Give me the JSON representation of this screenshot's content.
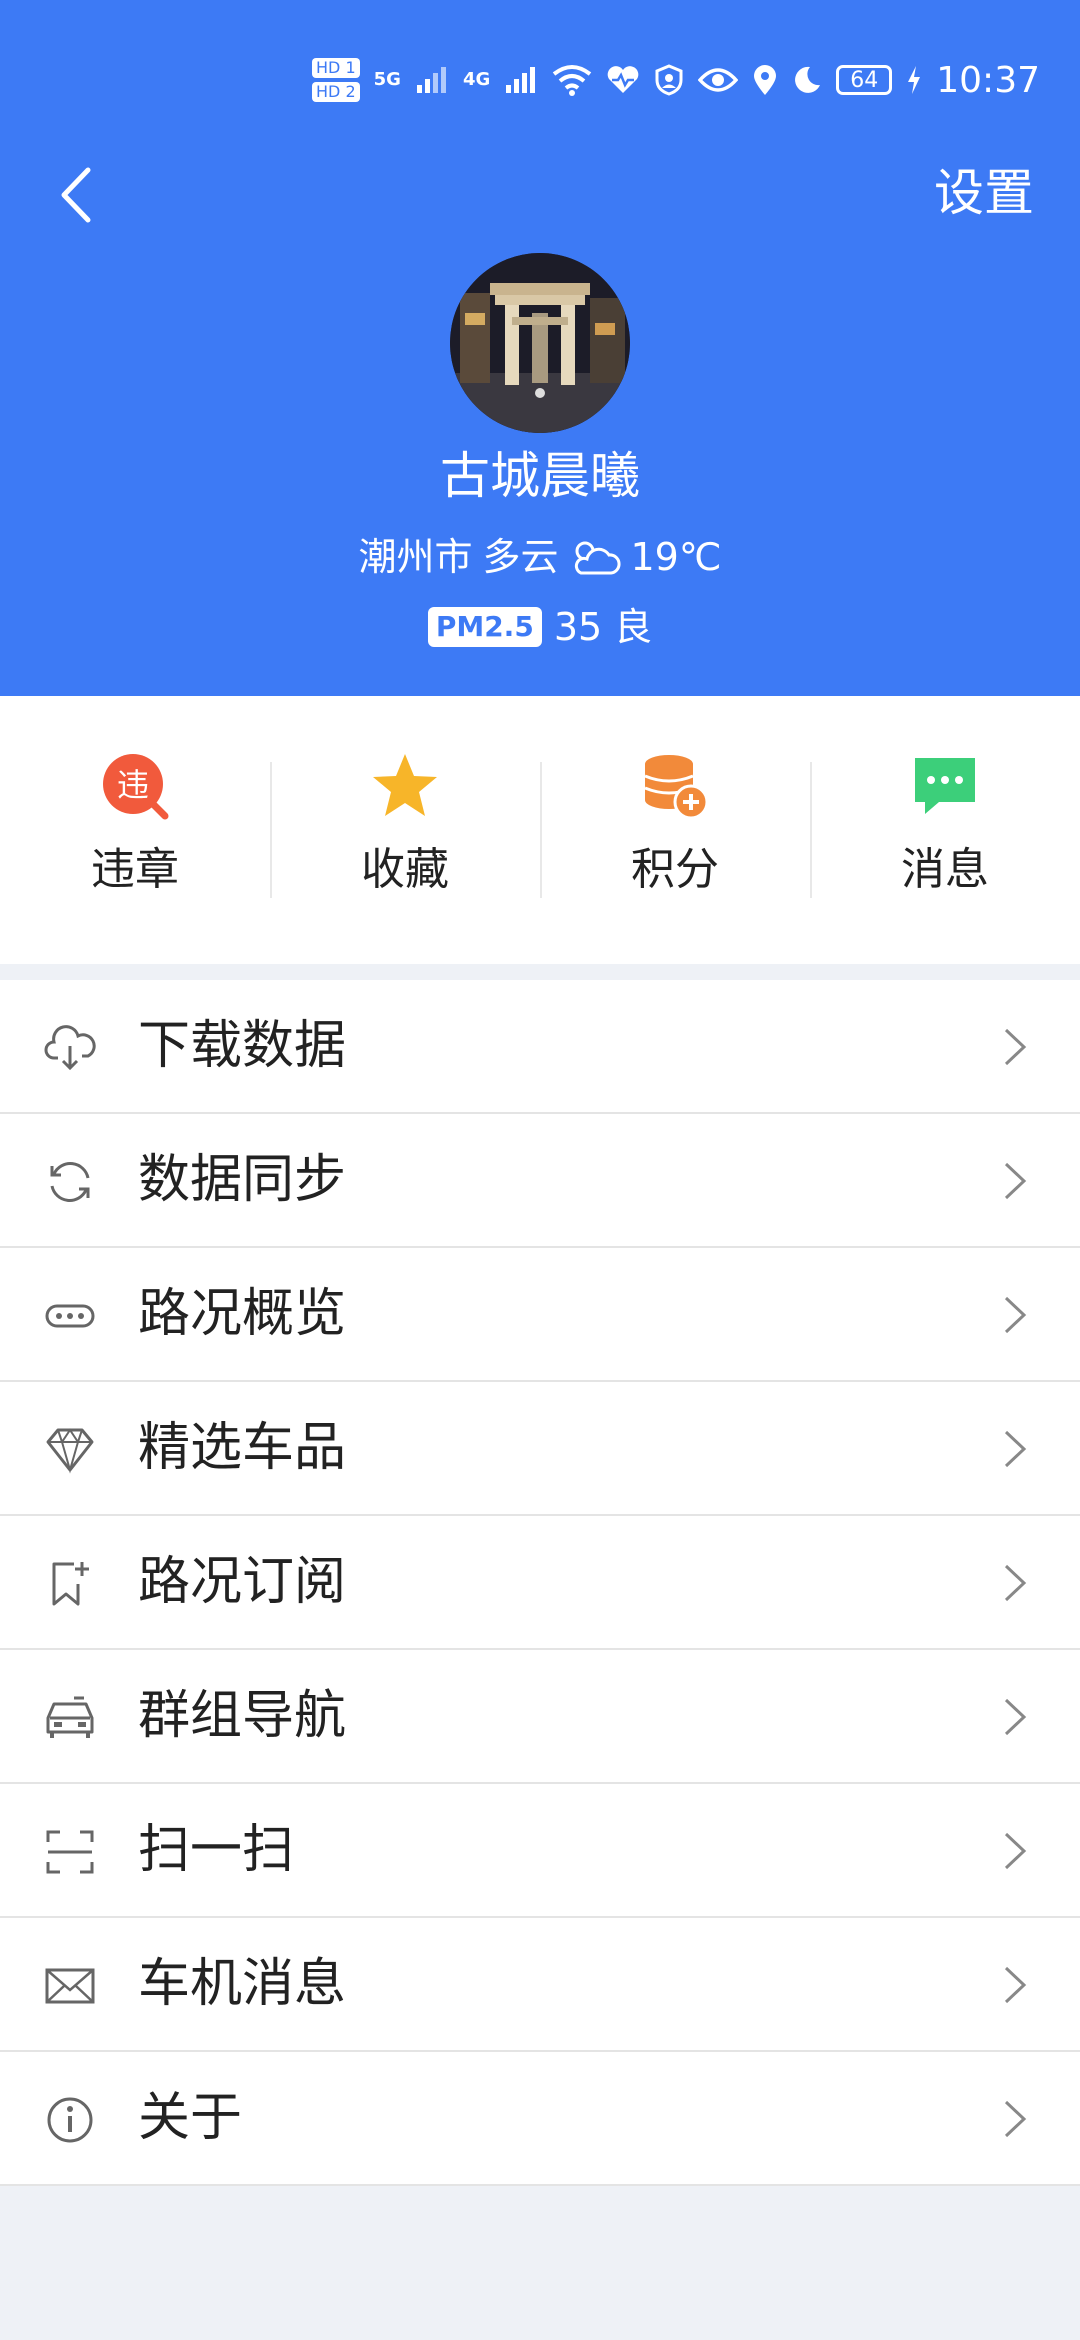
{
  "status_bar": {
    "hd1": "HD 1",
    "hd2": "HD 2",
    "net1": "5G",
    "net2": "4G",
    "battery": "64",
    "time": "10:37"
  },
  "header": {
    "settings_label": "设置",
    "user_name": "古城晨曦",
    "city": "潮州市",
    "weather": "多云",
    "temperature": "19℃",
    "pm_label": "PM2.5",
    "pm_value": "35",
    "pm_level": "良"
  },
  "quick_actions": [
    {
      "label": "违章",
      "icon": "violation-icon"
    },
    {
      "label": "收藏",
      "icon": "star-icon"
    },
    {
      "label": "积分",
      "icon": "points-icon"
    },
    {
      "label": "消息",
      "icon": "message-icon"
    }
  ],
  "menu": [
    {
      "label": "下载数据",
      "icon": "cloud-download-icon"
    },
    {
      "label": "数据同步",
      "icon": "sync-icon"
    },
    {
      "label": "路况概览",
      "icon": "traffic-overview-icon"
    },
    {
      "label": "精选车品",
      "icon": "diamond-icon"
    },
    {
      "label": "路况订阅",
      "icon": "bookmark-add-icon"
    },
    {
      "label": "群组导航",
      "icon": "car-icon"
    },
    {
      "label": "扫一扫",
      "icon": "scan-icon"
    },
    {
      "label": "车机消息",
      "icon": "mail-icon"
    },
    {
      "label": "关于",
      "icon": "info-icon"
    }
  ],
  "colors": {
    "header_bg": "#3d7af5",
    "violation": "#f15a3c",
    "star": "#f7b529",
    "points": "#f28a3a",
    "message": "#3ccf7a"
  }
}
